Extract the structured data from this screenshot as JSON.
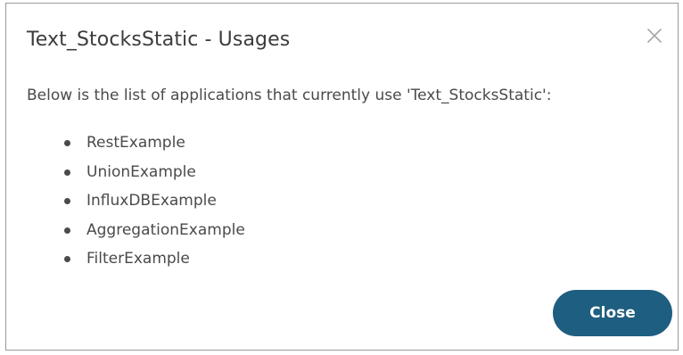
{
  "dialog": {
    "title": "Text_StocksStatic - Usages",
    "description": "Below is the list of applications that currently use 'Text_StocksStatic':",
    "applications": [
      "RestExample",
      "UnionExample",
      "InfluxDBExample",
      "AggregationExample",
      "FilterExample"
    ],
    "close_button_label": "Close",
    "close_icon": "close-icon",
    "accent_color": "#1e5e80"
  }
}
